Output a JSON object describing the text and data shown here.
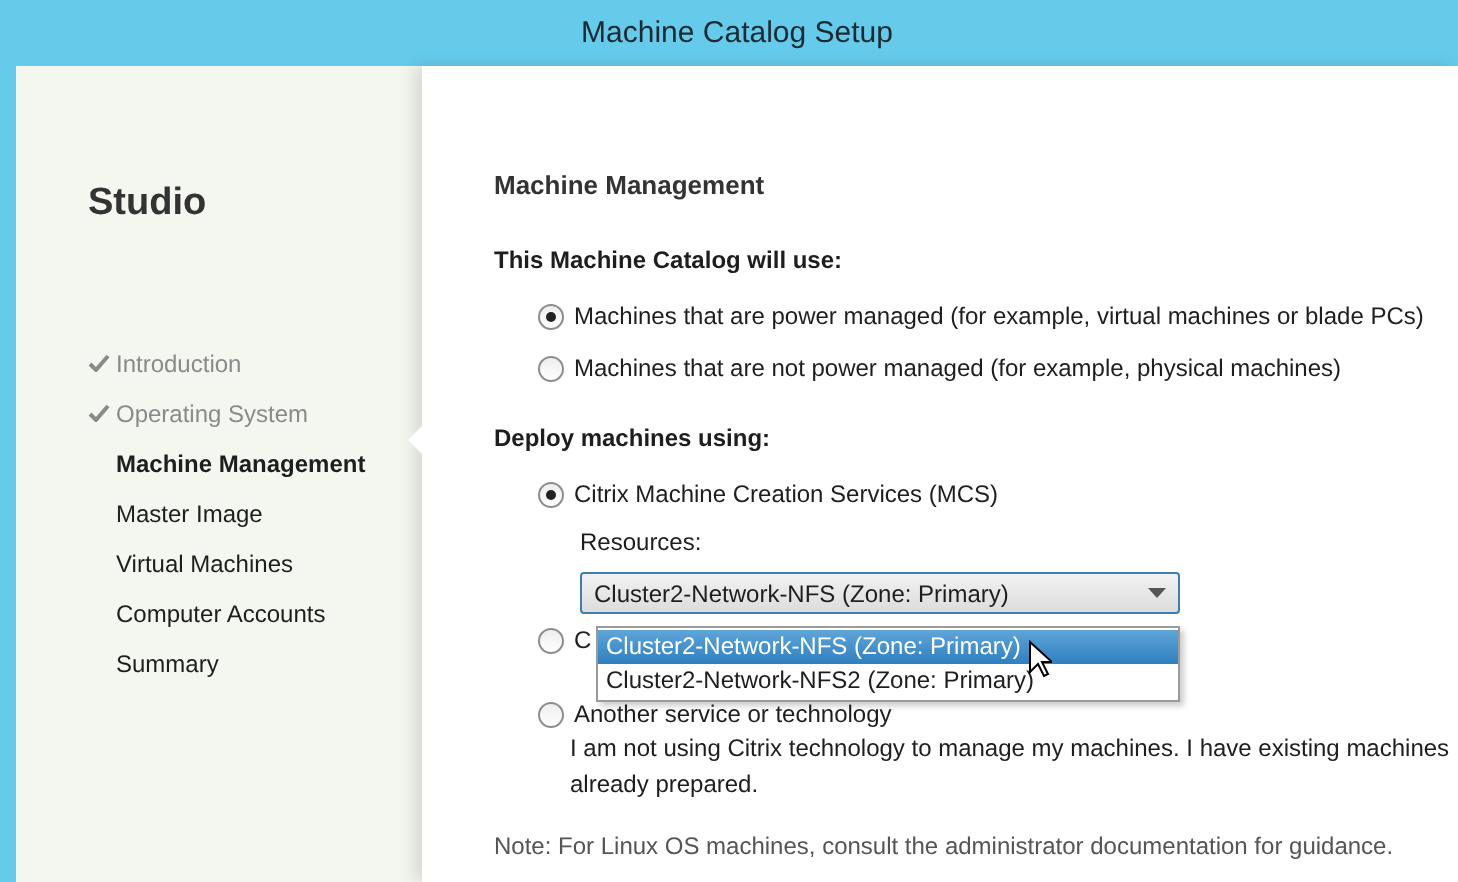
{
  "window": {
    "title": "Machine Catalog Setup"
  },
  "sidebar": {
    "title": "Studio",
    "items": [
      {
        "label": "Introduction",
        "done": true,
        "selected": false
      },
      {
        "label": "Operating System",
        "done": true,
        "selected": false
      },
      {
        "label": "Machine Management",
        "done": false,
        "selected": true
      },
      {
        "label": "Master Image",
        "done": false,
        "selected": false
      },
      {
        "label": "Virtual Machines",
        "done": false,
        "selected": false
      },
      {
        "label": "Computer Accounts",
        "done": false,
        "selected": false
      },
      {
        "label": "Summary",
        "done": false,
        "selected": false
      }
    ]
  },
  "page": {
    "heading": "Machine Management",
    "catalog_use": {
      "label": "This Machine Catalog will use:",
      "options": [
        {
          "label": "Machines that are power managed (for example, virtual machines or blade PCs)",
          "selected": true
        },
        {
          "label": "Machines that are not power managed (for example, physical machines)",
          "selected": false
        }
      ]
    },
    "deploy": {
      "label": "Deploy machines using:",
      "options": [
        {
          "label": "Citrix Machine Creation Services (MCS)",
          "selected": true,
          "kind": "resources"
        },
        {
          "label": "C",
          "selected": false,
          "kind": "plain"
        },
        {
          "label": "Another service or technology",
          "selected": false,
          "kind": "described",
          "description": "I am not using Citrix technology to manage my machines. I have existing machines already prepared."
        }
      ]
    },
    "resources": {
      "label": "Resources:",
      "value": "Cluster2-Network-NFS (Zone: Primary)",
      "expanded": true,
      "options": [
        {
          "label": "Cluster2-Network-NFS (Zone: Primary)",
          "selected": true
        },
        {
          "label": "Cluster2-Network-NFS2 (Zone: Primary)",
          "selected": false
        }
      ]
    },
    "note": "Note: For Linux OS machines, consult the administrator documentation for guidance."
  }
}
